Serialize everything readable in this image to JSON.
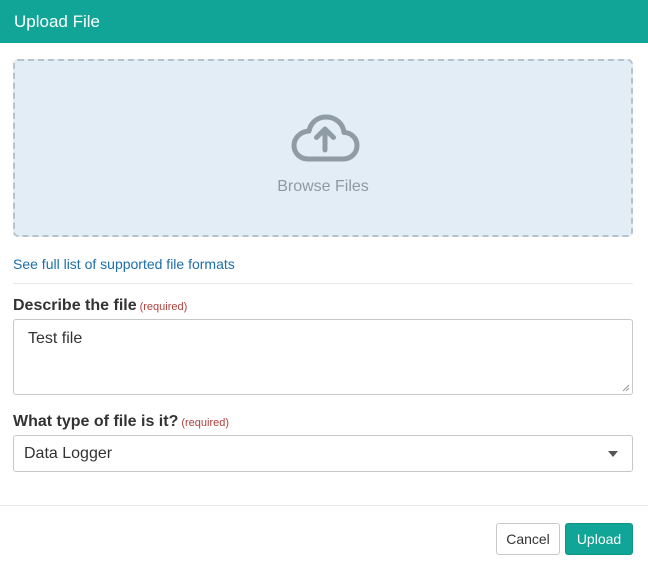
{
  "dialog": {
    "title": "Upload File"
  },
  "dropzone": {
    "icon": "cloud-upload-icon",
    "label": "Browse Files"
  },
  "formats_link": "See full list of supported file formats",
  "description_field": {
    "label": "Describe the file",
    "required": "(required)",
    "value": "Test file"
  },
  "type_field": {
    "label": "What type of file is it?",
    "required": "(required)",
    "selected": "Data Logger"
  },
  "actions": {
    "cancel_label": "Cancel",
    "upload_label": "Upload"
  },
  "colors": {
    "accent": "#10a596",
    "dropzone_bg": "#e3edf5",
    "link": "#1c6fa8",
    "required": "#b0413e"
  }
}
